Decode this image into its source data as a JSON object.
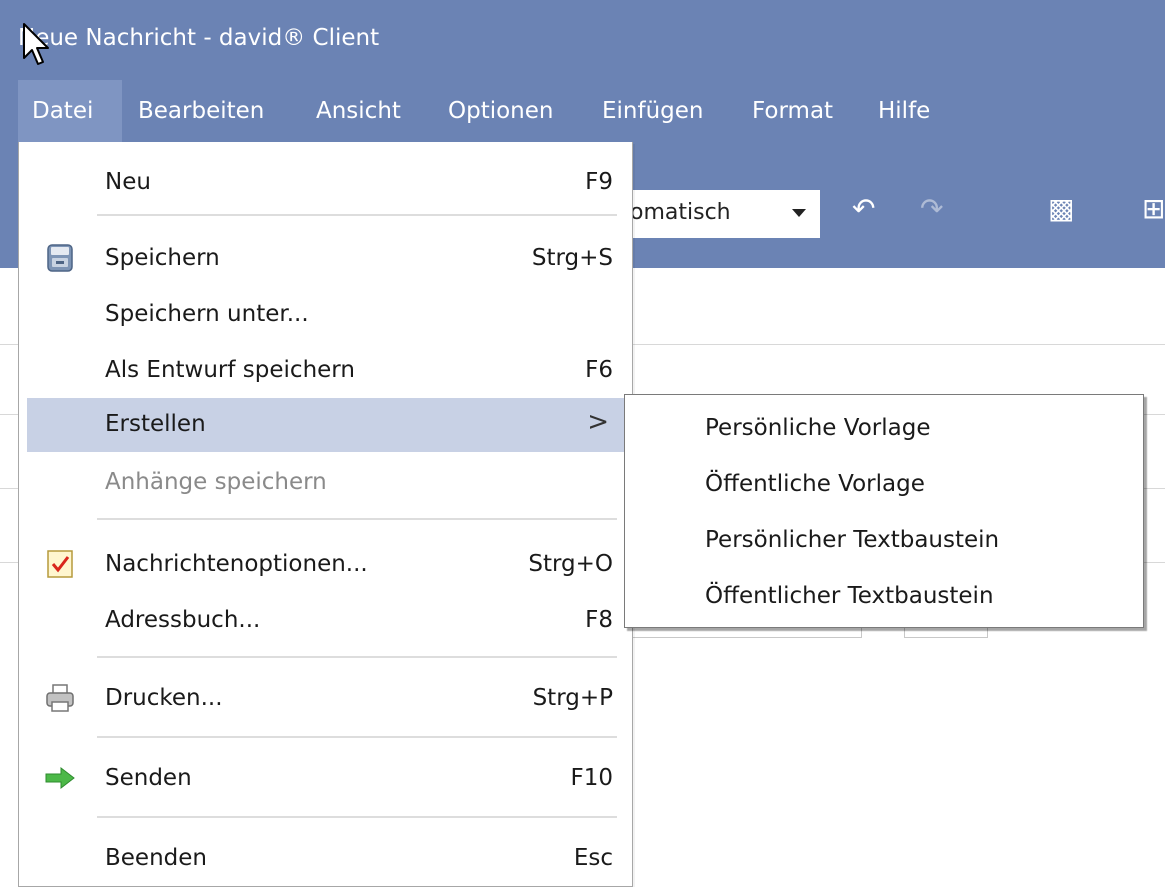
{
  "window": {
    "title": "Neue Nachricht - david® Client"
  },
  "menubar": [
    {
      "label": "Datei",
      "active": true
    },
    {
      "label": "Bearbeiten",
      "active": false
    },
    {
      "label": "Ansicht",
      "active": false
    },
    {
      "label": "Optionen",
      "active": false
    },
    {
      "label": "Einfügen",
      "active": false
    },
    {
      "label": "Format",
      "active": false
    },
    {
      "label": "Hilfe",
      "active": false
    }
  ],
  "toolbar": {
    "combo_value": "omatisch"
  },
  "dropdown": {
    "items": [
      {
        "label": "Neu",
        "shortcut": "F9",
        "icon": ""
      },
      {
        "label": "Speichern",
        "shortcut": "Strg+S",
        "icon": "save-icon"
      },
      {
        "label": "Speichern unter...",
        "shortcut": "",
        "icon": ""
      },
      {
        "label": "Als Entwurf speichern",
        "shortcut": "F6",
        "icon": ""
      },
      {
        "label": "Erstellen",
        "shortcut": "",
        "icon": "",
        "submenu_arrow": ">",
        "highlighted": true
      },
      {
        "label": "Anhänge speichern",
        "shortcut": "",
        "icon": "",
        "disabled": true
      },
      {
        "label": "Nachrichtenoptionen...",
        "shortcut": "Strg+O",
        "icon": "checklist-icon"
      },
      {
        "label": "Adressbuch...",
        "shortcut": "F8",
        "icon": ""
      },
      {
        "label": "Drucken...",
        "shortcut": "Strg+P",
        "icon": "printer-icon"
      },
      {
        "label": "Senden",
        "shortcut": "F10",
        "icon": "send-arrow-icon"
      },
      {
        "label": "Beenden",
        "shortcut": "Esc",
        "icon": ""
      }
    ]
  },
  "submenu": {
    "items": [
      {
        "label": "Persönliche Vorlage"
      },
      {
        "label": "Öffentliche Vorlage"
      },
      {
        "label": "Persönlicher Textbaustein"
      },
      {
        "label": "Öffentlicher Textbaustein"
      }
    ]
  },
  "colors": {
    "titlebar": "#6b83b4",
    "menu_highlight": "#c8d1e5",
    "send_icon": "#4cb848"
  }
}
